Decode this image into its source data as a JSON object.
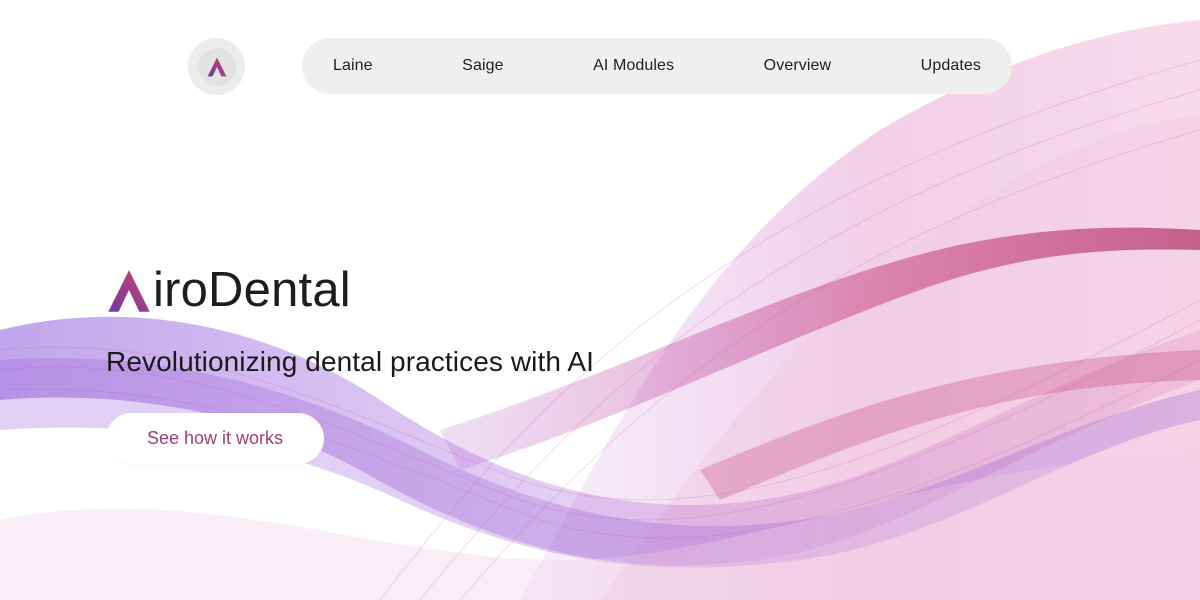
{
  "brand": {
    "name_rest": "iroDental",
    "logo_icon": "airodental-a-logo",
    "colors": {
      "purple": "#6b3fa0",
      "magenta": "#c13a72",
      "dark": "#1c1c22"
    }
  },
  "nav": {
    "items": [
      {
        "label": "Laine"
      },
      {
        "label": "Saige"
      },
      {
        "label": "AI Modules"
      },
      {
        "label": "Overview"
      },
      {
        "label": "Updates"
      }
    ]
  },
  "hero": {
    "tagline": "Revolutionizing dental practices with AI",
    "cta_label": "See how it works"
  },
  "theme": {
    "wave_pink": "#e3a6cf",
    "wave_purple": "#8a4fd6",
    "wave_magenta": "#c2366f",
    "cta_text": "#9c3f74"
  }
}
